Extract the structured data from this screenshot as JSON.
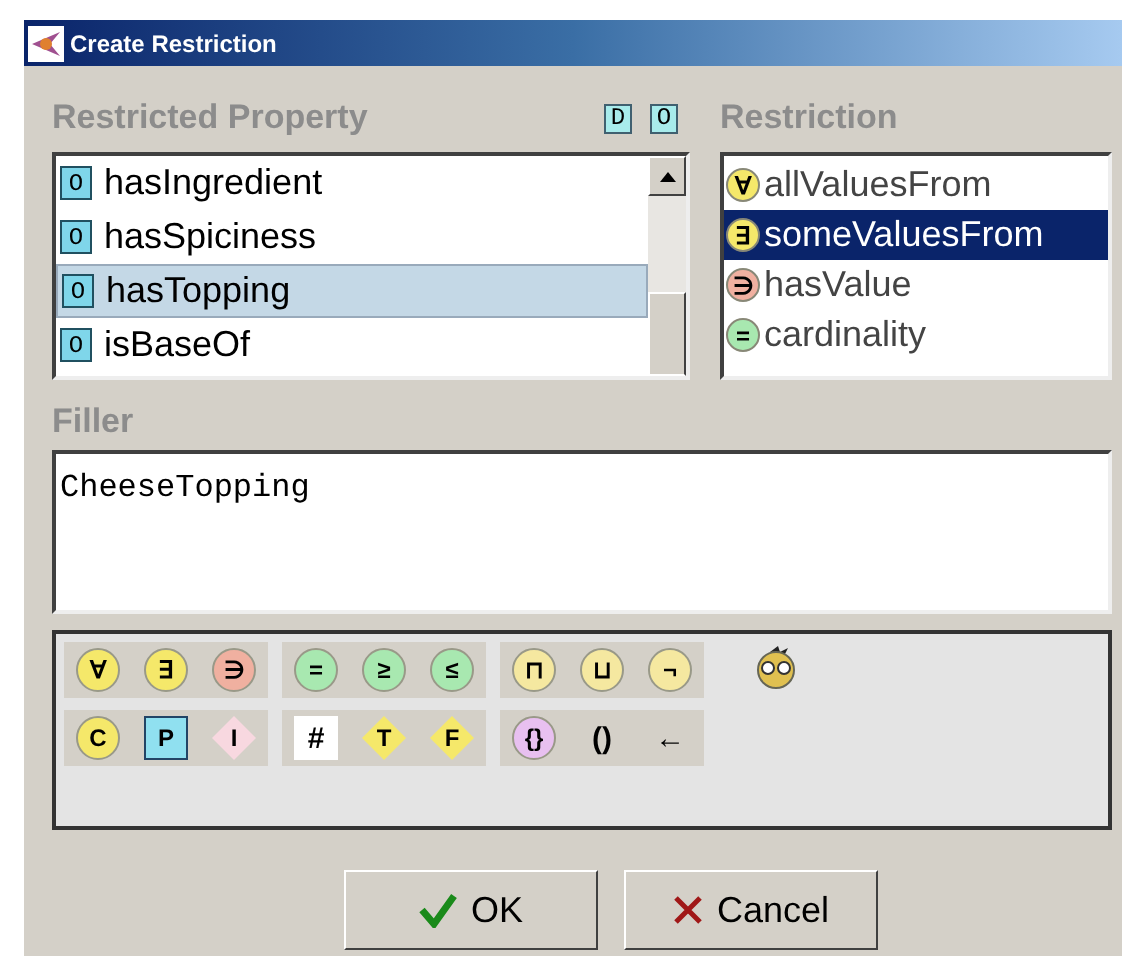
{
  "window": {
    "title": "Create Restriction"
  },
  "property_panel": {
    "title": "Restricted Property",
    "header_buttons": [
      {
        "badge": "D"
      },
      {
        "badge": "O"
      }
    ],
    "items": [
      {
        "badge": "O",
        "label": "hasIngredient",
        "selected": false
      },
      {
        "badge": "O",
        "label": "hasSpiciness",
        "selected": false
      },
      {
        "badge": "O",
        "label": "hasTopping",
        "selected": true
      },
      {
        "badge": "O",
        "label": "isBaseOf",
        "selected": false
      }
    ]
  },
  "restriction_panel": {
    "title": "Restriction",
    "items": [
      {
        "symbol": "∀",
        "label": "allValuesFrom",
        "color": "#f5e86a",
        "selected": false
      },
      {
        "symbol": "∃",
        "label": "someValuesFrom",
        "color": "#f5e86a",
        "selected": true
      },
      {
        "symbol": "∋",
        "label": "hasValue",
        "color": "#f0b0a0",
        "selected": false
      },
      {
        "symbol": "=",
        "label": "cardinality",
        "color": "#a8e8b0",
        "selected": false
      }
    ]
  },
  "filler": {
    "title": "Filler",
    "value": "CheeseTopping"
  },
  "palette": {
    "rows": [
      [
        [
          {
            "symbol": "∀",
            "kind": "circle",
            "color": "#f5e86a"
          },
          {
            "symbol": "∃",
            "kind": "circle",
            "color": "#f5e86a"
          },
          {
            "symbol": "∋",
            "kind": "circle",
            "color": "#f0b0a0"
          }
        ],
        [
          {
            "symbol": "=",
            "kind": "circle",
            "color": "#a8e8b0"
          },
          {
            "symbol": "≥",
            "kind": "circle",
            "color": "#a8e8b0"
          },
          {
            "symbol": "≤",
            "kind": "circle",
            "color": "#a8e8b0"
          }
        ],
        [
          {
            "symbol": "⊓",
            "kind": "circle",
            "color": "#f5e8a0"
          },
          {
            "symbol": "⊔",
            "kind": "circle",
            "color": "#f5e8a0"
          },
          {
            "symbol": "¬",
            "kind": "circle",
            "color": "#f5e8a0"
          }
        ]
      ],
      [
        [
          {
            "symbol": "C",
            "kind": "circle",
            "color": "#f5e86a"
          },
          {
            "symbol": "P",
            "kind": "square",
            "color": "#90e0f0"
          },
          {
            "symbol": "I",
            "kind": "diamond",
            "color": "#f8d8e0"
          }
        ],
        [
          {
            "symbol": "#",
            "kind": "plain",
            "color": "#ffffff"
          },
          {
            "symbol": "T",
            "kind": "diamond",
            "color": "#f5e86a"
          },
          {
            "symbol": "F",
            "kind": "diamond",
            "color": "#f5e86a"
          }
        ],
        [
          {
            "symbol": "{}",
            "kind": "circle",
            "color": "#e8c0f0"
          },
          {
            "symbol": "()",
            "kind": "plain",
            "color": "#d4d0c8"
          },
          {
            "symbol": "←",
            "kind": "plain",
            "color": "#d4d0c8"
          }
        ]
      ]
    ]
  },
  "buttons": [
    {
      "kind": "ok",
      "label": "OK"
    },
    {
      "kind": "cancel",
      "label": "Cancel"
    }
  ]
}
